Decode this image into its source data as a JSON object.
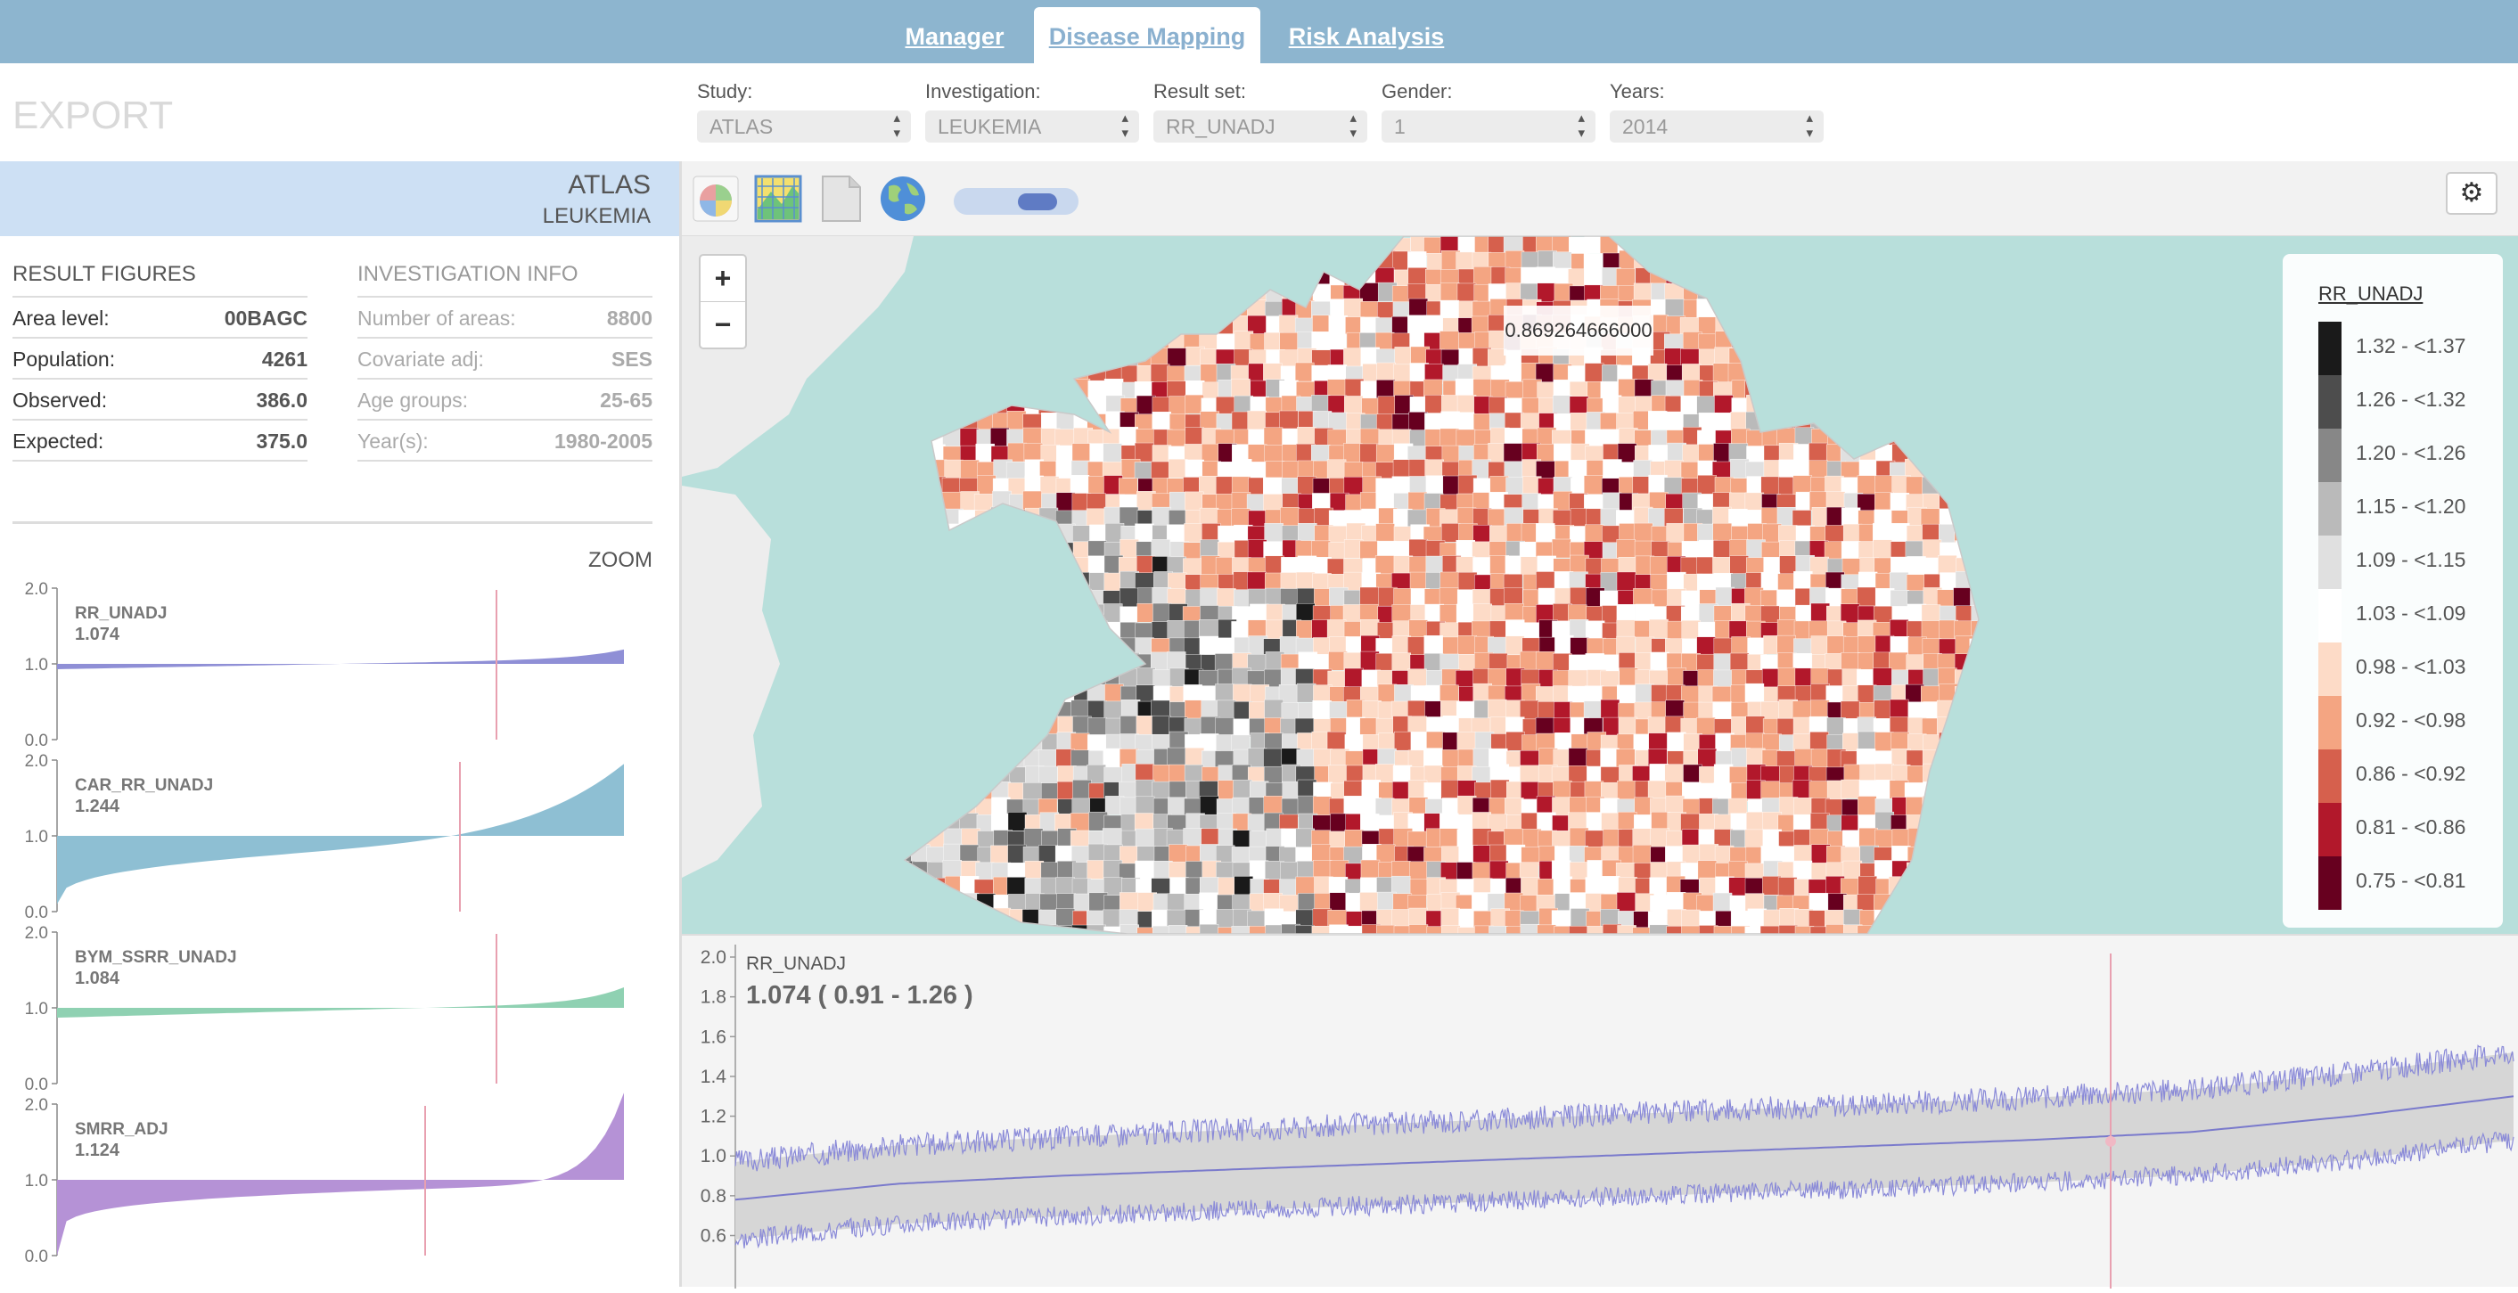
{
  "nav": {
    "tabs": [
      {
        "label": "Manager",
        "active": false
      },
      {
        "label": "Disease Mapping",
        "active": true
      },
      {
        "label": "Risk Analysis",
        "active": false
      }
    ]
  },
  "header": {
    "export_label": "EXPORT",
    "selectors": [
      {
        "label": "Study:",
        "value": "ATLAS"
      },
      {
        "label": "Investigation:",
        "value": "LEUKEMIA"
      },
      {
        "label": "Result set:",
        "value": "RR_UNADJ"
      },
      {
        "label": "Gender:",
        "value": "1"
      },
      {
        "label": "Years:",
        "value": "2014"
      }
    ]
  },
  "left_panel": {
    "title": "ATLAS",
    "subtitle": "LEUKEMIA",
    "result_figures": {
      "heading": "RESULT FIGURES",
      "rows": [
        {
          "key": "Area level:",
          "value": "00BAGC"
        },
        {
          "key": "Population:",
          "value": "4261"
        },
        {
          "key": "Observed:",
          "value": "386.0"
        },
        {
          "key": "Expected:",
          "value": "375.0"
        }
      ]
    },
    "investigation_info": {
      "heading": "INVESTIGATION INFO",
      "rows": [
        {
          "key": "Number of areas:",
          "value": "8800"
        },
        {
          "key": "Covariate adj:",
          "value": "SES"
        },
        {
          "key": "Age groups:",
          "value": "25-65"
        },
        {
          "key": "Year(s):",
          "value": "1980-2005"
        }
      ]
    },
    "zoom_label": "ZOOM",
    "mini_charts": [
      {
        "name": "RR_UNADJ",
        "value": "1.074",
        "color": "#8f8fd6",
        "ticks": [
          "2.0",
          "1.0",
          "0.0"
        ]
      },
      {
        "name": "CAR_RR_UNADJ",
        "value": "1.244",
        "color": "#8ebfd3",
        "ticks": [
          "2.0",
          "1.0",
          "0.0"
        ]
      },
      {
        "name": "BYM_SSRR_UNADJ",
        "value": "1.084",
        "color": "#8fd1b2",
        "ticks": [
          "2.0",
          "1.0",
          "0.0"
        ]
      },
      {
        "name": "SMRR_ADJ",
        "value": "1.124",
        "color": "#b592d6",
        "ticks": [
          "2.0",
          "1.0",
          "0.0"
        ]
      }
    ]
  },
  "map": {
    "zoom_in": "+",
    "zoom_out": "−",
    "tooltip": "0.869264666000",
    "settings_icon": "⚙",
    "legend": {
      "title": "RR_UNADJ",
      "items": [
        {
          "label": "1.32 - <1.37",
          "color": "#1a1a1a"
        },
        {
          "label": "1.26 - <1.32",
          "color": "#4d4d4d"
        },
        {
          "label": "1.20 - <1.26",
          "color": "#878787"
        },
        {
          "label": "1.15 - <1.20",
          "color": "#bababa"
        },
        {
          "label": "1.09 - <1.15",
          "color": "#e0e0e0"
        },
        {
          "label": "1.03 - <1.09",
          "color": "#ffffff"
        },
        {
          "label": "0.98 - <1.03",
          "color": "#fddbc7"
        },
        {
          "label": "0.92 - <0.98",
          "color": "#f4a582"
        },
        {
          "label": "0.86 - <0.92",
          "color": "#d6604d"
        },
        {
          "label": "0.81 - <0.86",
          "color": "#b2182b"
        },
        {
          "label": "0.75 - <0.81",
          "color": "#67001f"
        }
      ]
    }
  },
  "bottom_chart": {
    "title": "RR_UNADJ",
    "value_text": "1.074 ( 0.91 - 1.26 )",
    "y_ticks": [
      "2.0",
      "1.8",
      "1.6",
      "1.4",
      "1.2",
      "1.0",
      "0.8",
      "0.6"
    ]
  },
  "chart_data": {
    "type": "area",
    "title": "RR_UNADJ",
    "ylim": [
      0.5,
      2.0
    ],
    "series": [
      {
        "name": "RR_UNADJ",
        "values": [
          0.78,
          0.86,
          0.9,
          0.93,
          0.96,
          0.99,
          1.02,
          1.05,
          1.08,
          1.12,
          1.2,
          1.3
        ]
      }
    ],
    "selected": {
      "value": 1.074,
      "lower": 0.91,
      "upper": 1.26
    }
  }
}
